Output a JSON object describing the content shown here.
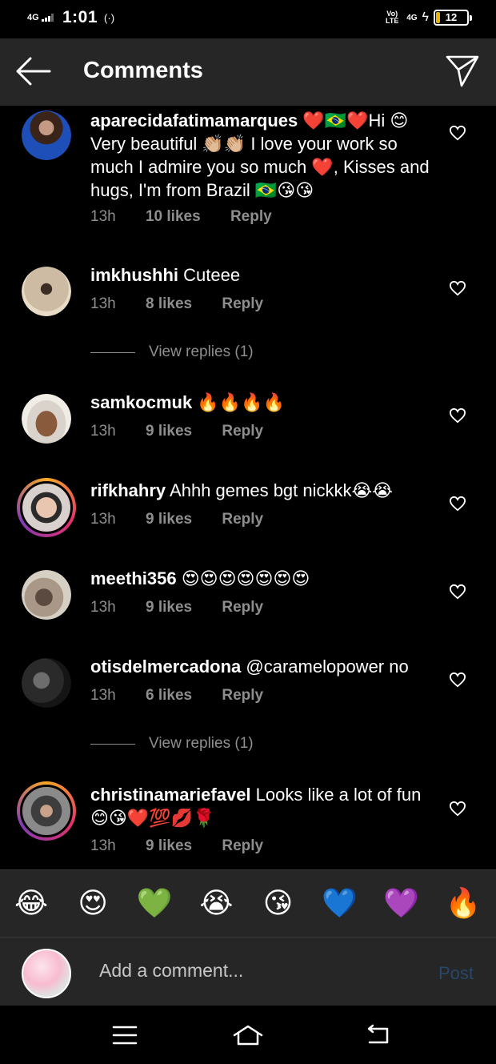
{
  "status_bar": {
    "network": "4G",
    "time": "1:01",
    "volte": "Vo) LTE",
    "network2": "4G",
    "battery": "12",
    "battery_level_percent": 12
  },
  "header": {
    "title": "Comments",
    "back_icon": "arrow-left-icon",
    "send_icon": "paper-plane-icon"
  },
  "comments": [
    {
      "username": "aparecidafatimamarques",
      "text": " ❤️🇧🇷❤️Hi 😊 Very beautiful 👏🏼👏🏼 I love your work so much I admire you so much ❤️, Kisses and hugs, I'm from Brazil 🇧🇷😘😘",
      "time": "13h",
      "likes": "10 likes",
      "reply": "Reply"
    },
    {
      "username": "imkhushhi",
      "text": " Cuteee",
      "time": "13h",
      "likes": "8 likes",
      "reply": "Reply",
      "view_replies": "View replies (1)"
    },
    {
      "username": "samkocmuk",
      "text": " 🔥🔥🔥🔥",
      "time": "13h",
      "likes": "9 likes",
      "reply": "Reply"
    },
    {
      "username": "rifkhahry",
      "text": " Ahhh gemes bgt nickkk😭😭",
      "time": "13h",
      "likes": "9 likes",
      "reply": "Reply"
    },
    {
      "username": "meethi356",
      "text": " 😍😍😍😍😍😍😍",
      "time": "13h",
      "likes": "9 likes",
      "reply": "Reply"
    },
    {
      "username": "otisdelmercadona",
      "text": " @caramelopower no",
      "time": "13h",
      "likes": "6 likes",
      "reply": "Reply",
      "view_replies": "View replies (1)"
    },
    {
      "username": "christinamariefavel",
      "text": " Looks like a lot of fun 😊😘❤️💯💋🌹",
      "time": "13h",
      "likes": "9 likes",
      "reply": "Reply"
    }
  ],
  "emoji_bar": [
    "😂",
    "😍",
    "💚",
    "😭",
    "😘",
    "💙",
    "💜",
    "🔥"
  ],
  "input": {
    "placeholder": "Add a comment...",
    "post_label": "Post"
  },
  "colors": {
    "background": "#000000",
    "header_bg": "#262626",
    "meta_text": "#8e8e8e",
    "post_disabled": "#27486b"
  }
}
